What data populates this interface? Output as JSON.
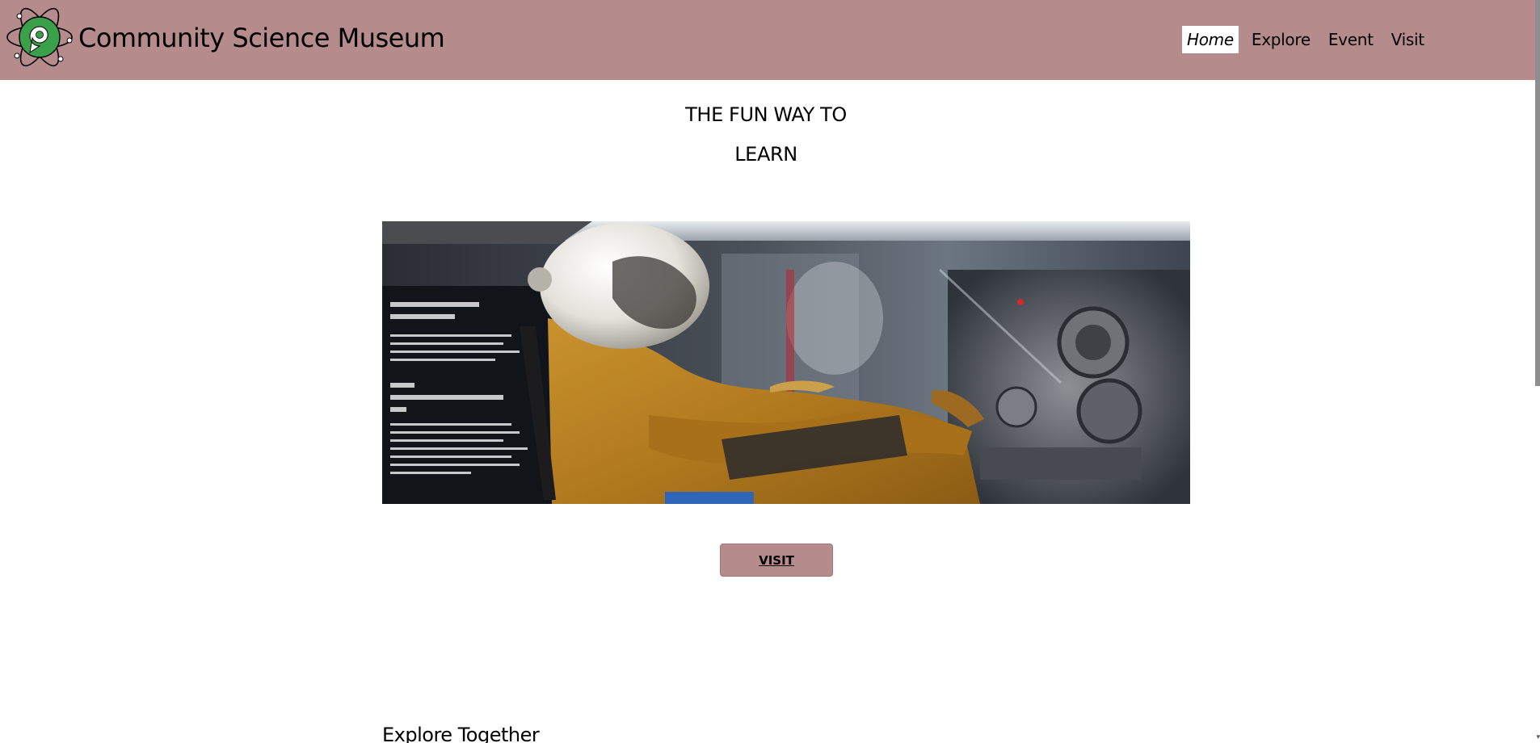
{
  "header": {
    "site_title": "Community Science Museum",
    "background_color": "#b68b8c",
    "logo_icon": "atom-logo-icon"
  },
  "nav": {
    "items": [
      {
        "label": "Home",
        "active": true
      },
      {
        "label": "Explore",
        "active": false
      },
      {
        "label": "Event",
        "active": false
      },
      {
        "label": "Visit",
        "active": false
      }
    ]
  },
  "hero": {
    "tagline_line1": "THE FUN WAY TO",
    "tagline_line2": "LEARN",
    "image_subject": "astronaut-in-cockpit-photo",
    "visit_button_label": "VISIT"
  },
  "sections": {
    "explore_heading": "Explore Together"
  }
}
